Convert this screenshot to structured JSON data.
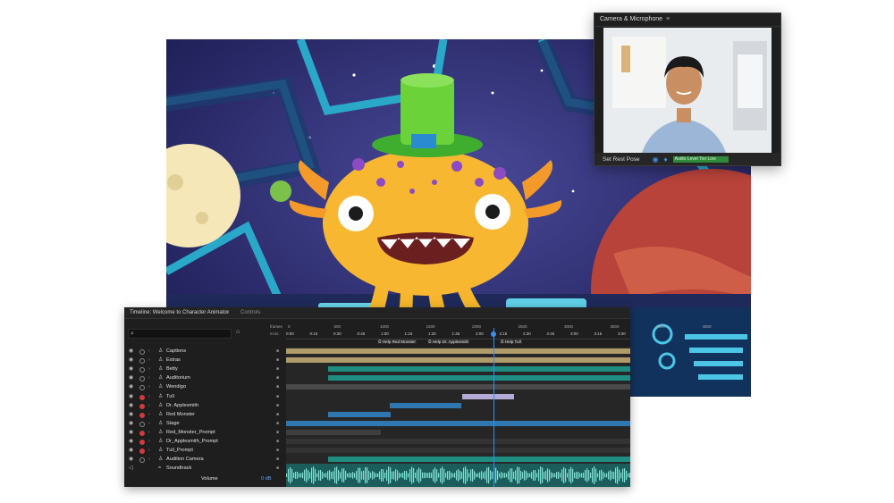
{
  "camera_panel": {
    "title": "Camera & Microphone",
    "menu_icon": "≡",
    "set_rest_pose": "Set Rest Pose",
    "audio_status": "Audio Level Too Low"
  },
  "timeline": {
    "tab_title": "Timeline: Welcome to Character Animator",
    "tab_menu_icon": "≡",
    "tab_controls": "Controls",
    "search_icon": "⌕",
    "ruler_labels": {
      "frames": "frames",
      "ms": "m:ss",
      "frame_ticks": [
        "0",
        "500",
        "1000",
        "1500",
        "2000",
        "2500",
        "3000",
        "3500",
        "4000",
        "4500"
      ],
      "time_ticks": [
        "0:00",
        "0:15",
        "0:30",
        "0:45",
        "1:00",
        "1:15",
        "1:30",
        "1:45",
        "2:00",
        "2:15",
        "2:30",
        "2:45",
        "3:00",
        "3:15",
        "3:30"
      ]
    },
    "markers": [
      "Help Red Monster",
      "Help Dr. Applesmith",
      "Help Tull"
    ],
    "rows": [
      {
        "name": "Captions",
        "rec": false
      },
      {
        "name": "Extras",
        "rec": false
      },
      {
        "name": "Betty",
        "rec": false
      },
      {
        "name": "Auditorium",
        "rec": false
      },
      {
        "name": "Wendigo",
        "rec": false
      },
      {
        "name": "Tull",
        "rec": true
      },
      {
        "name": "Dr. Applesmith",
        "rec": true
      },
      {
        "name": "Red Monster",
        "rec": true
      },
      {
        "name": "Stage",
        "rec": false
      },
      {
        "name": "Red_Monster_Prompt",
        "rec": true
      },
      {
        "name": "Dr_Applesmith_Prompt",
        "rec": true
      },
      {
        "name": "Tull_Prompt",
        "rec": true
      },
      {
        "name": "Audition Camera",
        "rec": false
      },
      {
        "name": "Soundtrack",
        "rec": false
      }
    ],
    "volume_label": "Volume",
    "volume_value": "0 dB"
  },
  "colors": {
    "accent_blue": "#3c8ee6",
    "record_red": "#d43a3a",
    "track_tan": "#b09b6a",
    "track_teal": "#1f8d82",
    "track_blue": "#2f77b0",
    "track_lavender": "#b5a9d6"
  }
}
